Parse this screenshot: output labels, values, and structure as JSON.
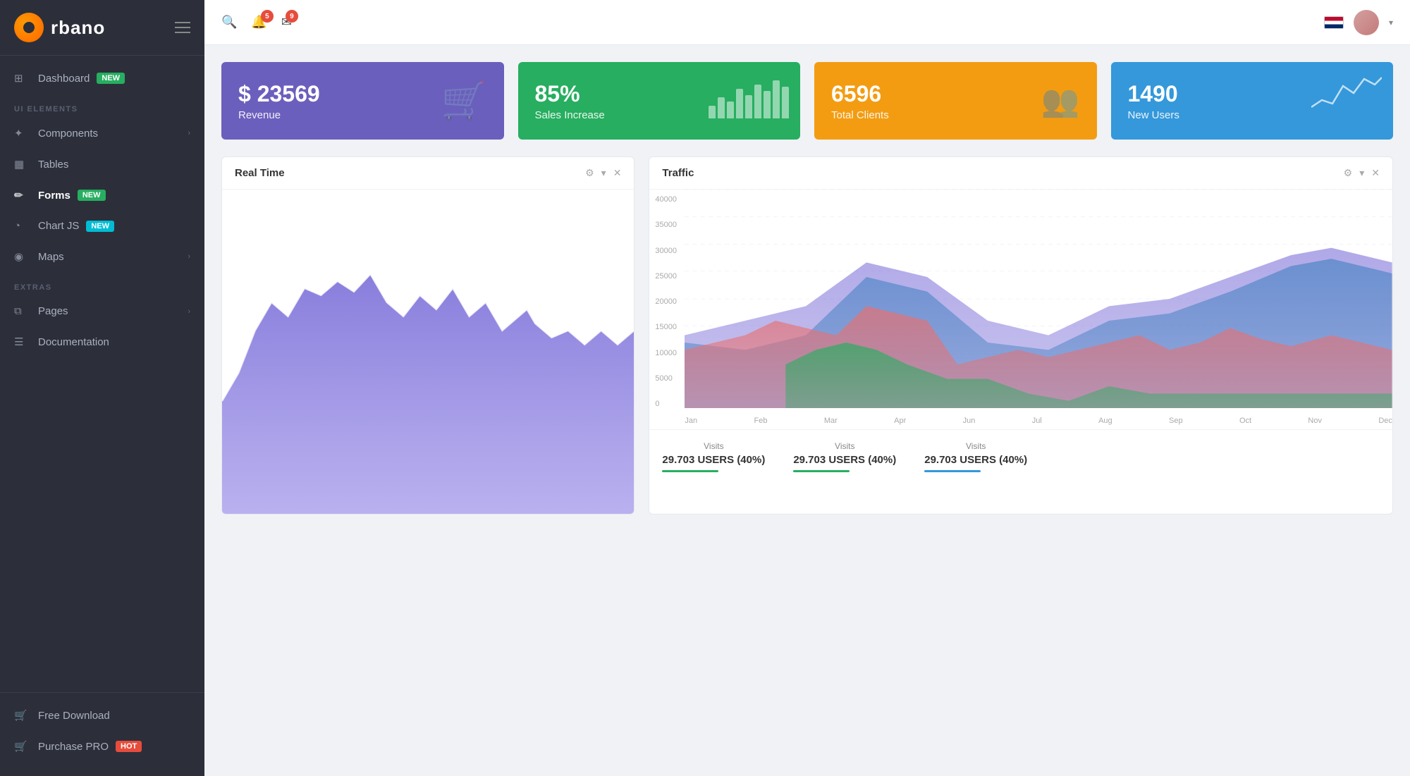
{
  "app": {
    "logo_letter": "r",
    "logo_name": "rbano"
  },
  "sidebar": {
    "sections": [
      {
        "label": "",
        "items": [
          {
            "id": "dashboard",
            "icon": "⊞",
            "label": "Dashboard",
            "badge": "NEW",
            "badge_color": "green",
            "arrow": false,
            "active": false
          }
        ]
      },
      {
        "label": "UI ELEMENTS",
        "items": [
          {
            "id": "components",
            "icon": "✦",
            "label": "Components",
            "badge": null,
            "arrow": true,
            "active": false
          },
          {
            "id": "tables",
            "icon": "▦",
            "label": "Tables",
            "badge": null,
            "arrow": false,
            "active": false
          },
          {
            "id": "forms",
            "icon": "✏",
            "label": "Forms",
            "badge": "NEW",
            "badge_color": "green",
            "arrow": false,
            "active": true
          },
          {
            "id": "chartjs",
            "icon": "◔",
            "label": "Chart JS",
            "badge": "NEW",
            "badge_color": "cyan",
            "arrow": false,
            "active": false
          },
          {
            "id": "maps",
            "icon": "◉",
            "label": "Maps",
            "badge": null,
            "arrow": true,
            "active": false
          }
        ]
      },
      {
        "label": "EXTRAS",
        "items": [
          {
            "id": "pages",
            "icon": "⧉",
            "label": "Pages",
            "badge": null,
            "arrow": true,
            "active": false
          },
          {
            "id": "documentation",
            "icon": "☰",
            "label": "Documentation",
            "badge": null,
            "arrow": false,
            "active": false
          }
        ]
      },
      {
        "label": "",
        "items": [
          {
            "id": "freedownload",
            "icon": "🛒",
            "label": "Free Download",
            "badge": null,
            "arrow": false,
            "active": false
          },
          {
            "id": "purchasepro",
            "icon": "🛒",
            "label": "Purchase PRO",
            "badge": "HOT",
            "badge_color": "red",
            "arrow": false,
            "active": false
          }
        ]
      }
    ]
  },
  "topbar": {
    "notification_count": "5",
    "mail_count": "9"
  },
  "stat_cards": [
    {
      "id": "revenue",
      "value": "$ 23569",
      "label": "Revenue",
      "color": "purple",
      "icon": "🛒"
    },
    {
      "id": "sales",
      "value": "85%",
      "label": "Sales Increase",
      "color": "green",
      "icon": "bars"
    },
    {
      "id": "clients",
      "value": "6596",
      "label": "Total Clients",
      "color": "orange",
      "icon": "👥"
    },
    {
      "id": "users",
      "value": "1490",
      "label": "New Users",
      "color": "blue",
      "icon": "sparkline"
    }
  ],
  "charts": {
    "realtime": {
      "title": "Real Time",
      "controls": [
        "gear",
        "chevron",
        "close"
      ]
    },
    "traffic": {
      "title": "Traffic",
      "controls": [
        "gear",
        "chevron",
        "close"
      ],
      "yaxis": [
        "40000",
        "35000",
        "30000",
        "25000",
        "20000",
        "15000",
        "10000",
        "5000",
        "0"
      ],
      "xaxis": [
        "Jan",
        "Feb",
        "Mar",
        "Apr",
        "Jun",
        "Jul",
        "Aug",
        "Sep",
        "Oct",
        "Nov",
        "Dec"
      ],
      "legend": [
        {
          "label": "Visits",
          "value": "29.703 USERS (40%)",
          "color": "#27ae60"
        },
        {
          "label": "Visits",
          "value": "29.703 USERS (40%)",
          "color": "#27ae60"
        },
        {
          "label": "Visits",
          "value": "29.703 USERS (40%)",
          "color": "#3498db"
        }
      ]
    }
  }
}
